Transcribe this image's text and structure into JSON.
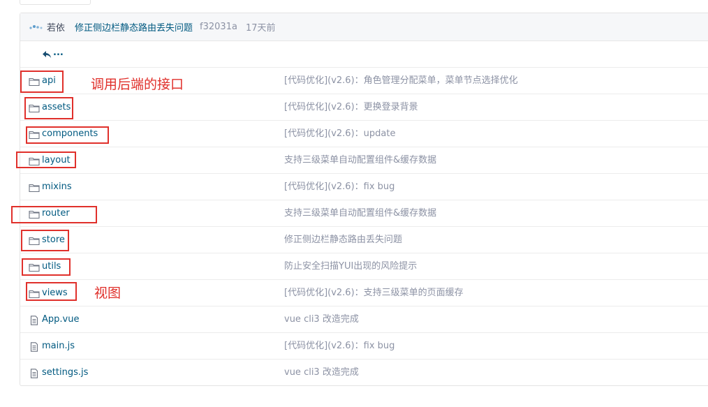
{
  "commit": {
    "author": "若依",
    "message": "修正侧边栏静态路由丢失问题",
    "hash": "f32031a",
    "time": "17天前"
  },
  "back_link": {
    "label": "..."
  },
  "entries": [
    {
      "type": "folder",
      "name": "api",
      "message": "[代码优化](v2.6)：角色管理分配菜单，菜单节点选择优化"
    },
    {
      "type": "folder",
      "name": "assets",
      "message": "[代码优化](v2.6)：更换登录背景"
    },
    {
      "type": "folder",
      "name": "components",
      "message": "[代码优化](v2.6)：update"
    },
    {
      "type": "folder",
      "name": "layout",
      "message": "支持三级菜单自动配置组件&缓存数据"
    },
    {
      "type": "folder",
      "name": "mixins",
      "message": "[代码优化](v2.6)：fix bug"
    },
    {
      "type": "folder",
      "name": "router",
      "message": "支持三级菜单自动配置组件&缓存数据"
    },
    {
      "type": "folder",
      "name": "store",
      "message": "修正侧边栏静态路由丢失问题"
    },
    {
      "type": "folder",
      "name": "utils",
      "message": "防止安全扫描YUI出现的风险提示"
    },
    {
      "type": "folder",
      "name": "views",
      "message": "[代码优化](v2.6)：支持三级菜单的页面缓存"
    },
    {
      "type": "file",
      "name": "App.vue",
      "message": "vue cli3 改造完成"
    },
    {
      "type": "file",
      "name": "main.js",
      "message": "[代码优化](v2.6)：fix bug"
    },
    {
      "type": "file",
      "name": "settings.js",
      "message": "vue cli3 改造完成"
    }
  ],
  "annotations": {
    "api_note": "调用后端的接口",
    "views_note": "视图"
  },
  "colors": {
    "link": "#005980",
    "muted": "#8c92a4",
    "annotation_red": "#e0302b"
  }
}
